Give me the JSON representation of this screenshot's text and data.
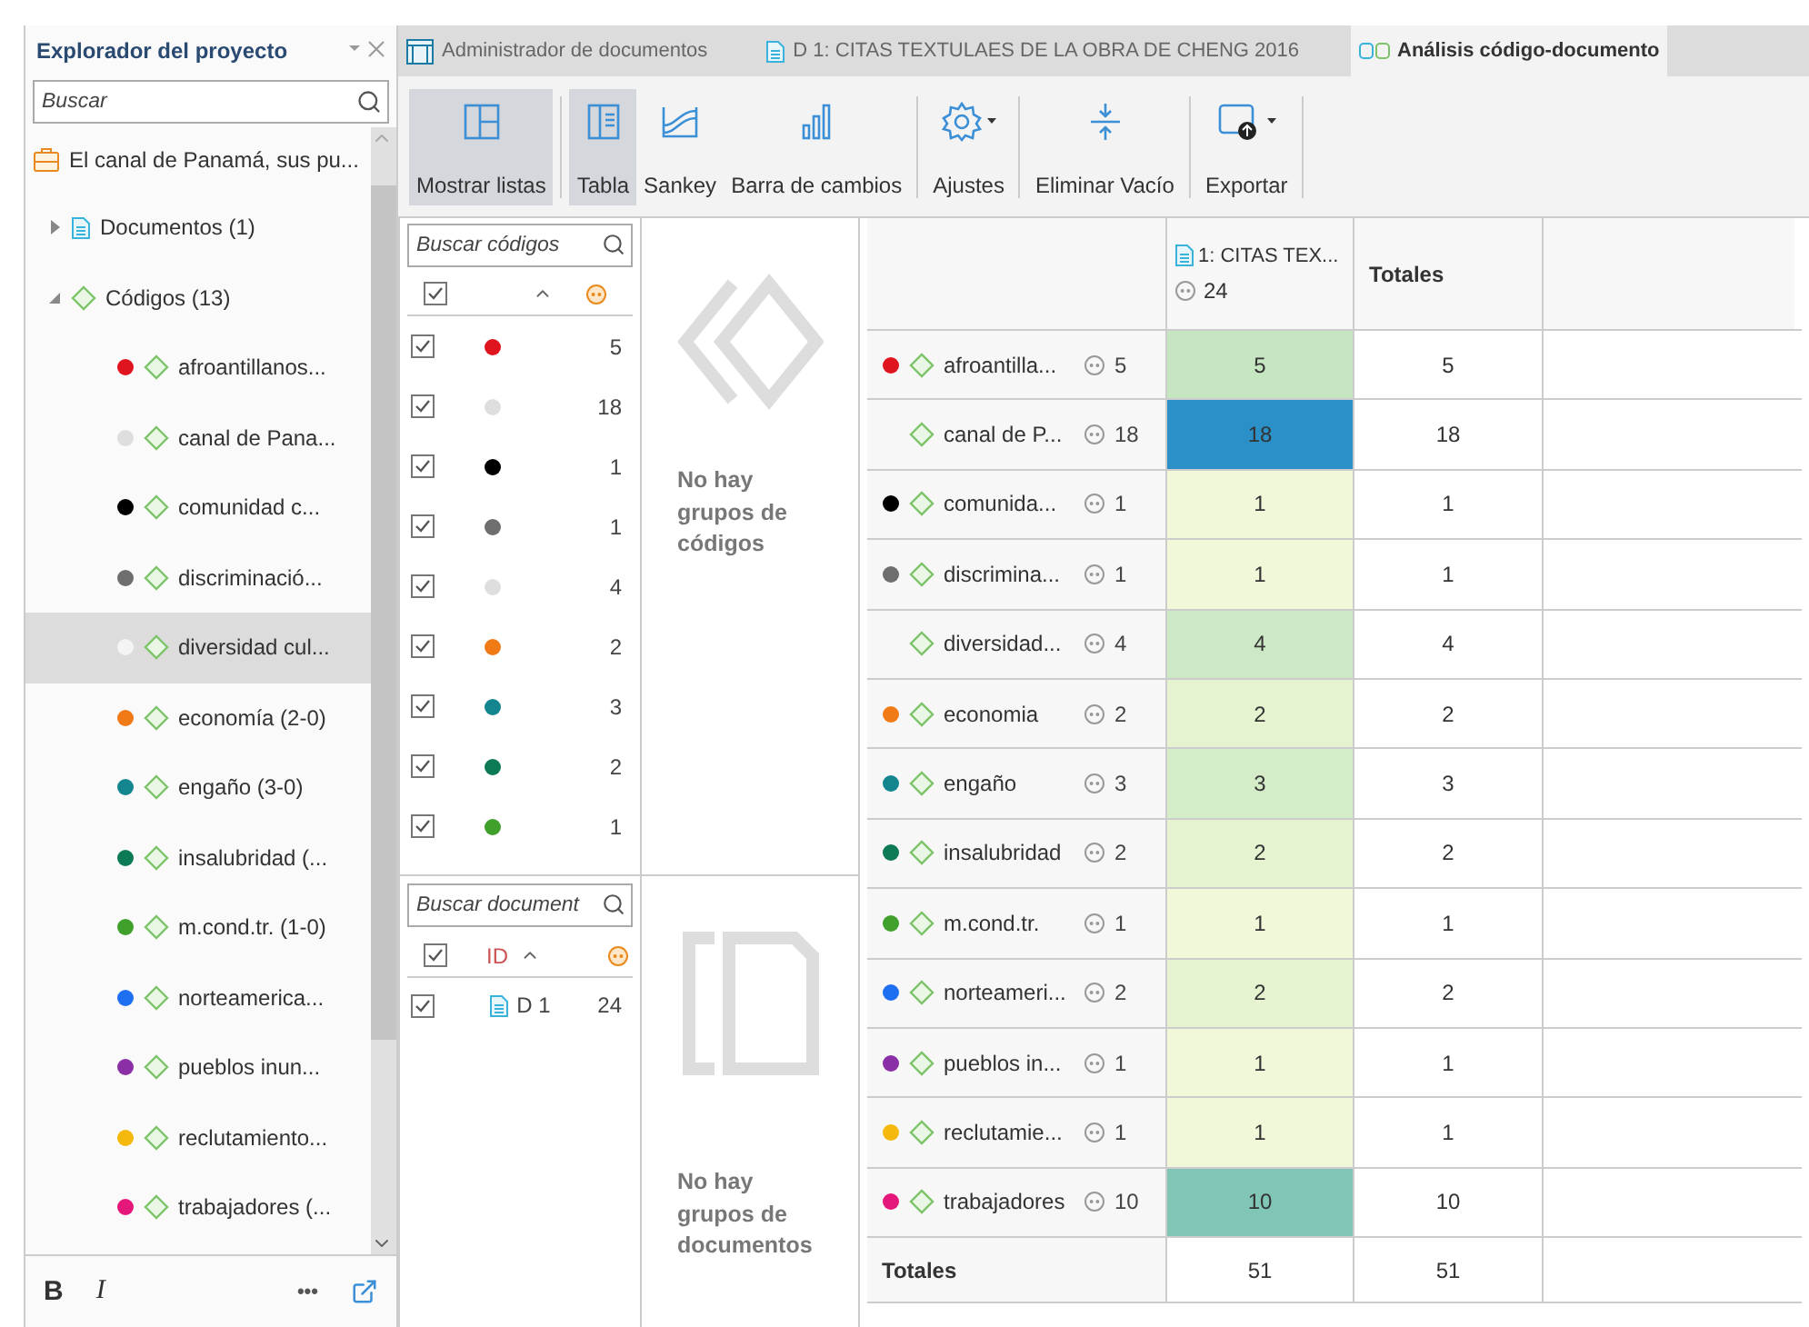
{
  "explorer": {
    "title": "Explorador del proyecto",
    "search": {
      "placeholder": "Buscar"
    },
    "project": "El canal de Panamá, sus pu...",
    "tree": [
      {
        "kind": "documents",
        "label": "Documentos (1)",
        "expanded": false
      },
      {
        "kind": "codes",
        "label": "Códigos (13)",
        "expanded": true,
        "children": [
          {
            "label": "afroantillanos...",
            "color": "#e0141e",
            "selected": false
          },
          {
            "label": "canal de Pana...",
            "color": "#dedede",
            "selected": false
          },
          {
            "label": "comunidad c...",
            "color": "#000000",
            "selected": false
          },
          {
            "label": "discriminació...",
            "color": "#6e6e6e",
            "selected": false
          },
          {
            "label": "diversidad cul...",
            "color": "#f4f4f4",
            "selected": true
          },
          {
            "label": "economía (2-0)",
            "color": "#f07a16",
            "selected": false
          },
          {
            "label": "engaño (3-0)",
            "color": "#13858f",
            "selected": false
          },
          {
            "label": "insalubridad (...",
            "color": "#0b7a55",
            "selected": false
          },
          {
            "label": "m.cond.tr. (1-0)",
            "color": "#3fa02c",
            "selected": false
          },
          {
            "label": "norteamerica...",
            "color": "#1f6ff2",
            "selected": false
          },
          {
            "label": "pueblos inun...",
            "color": "#8a2fa6",
            "selected": false
          },
          {
            "label": "reclutamiento...",
            "color": "#f5b90e",
            "selected": false
          },
          {
            "label": "trabajadores (...",
            "color": "#e5177a",
            "selected": false
          }
        ]
      }
    ],
    "footer": {
      "bold": "B",
      "italic": "I",
      "more": "•••"
    }
  },
  "tabs": [
    {
      "label": "Administrador de documentos",
      "kind": "manager",
      "selected": false
    },
    {
      "label": "D 1: CITAS TEXTULAES DE LA OBRA DE CHENG 2016",
      "kind": "document",
      "selected": false
    },
    {
      "label": "Análisis código-documento",
      "kind": "analysis",
      "selected": true
    }
  ],
  "toolbar": [
    {
      "label": "Mostrar listas",
      "kind": "lists",
      "selected": true,
      "menu": false
    },
    {
      "label": "Tabla",
      "kind": "table",
      "selected": true,
      "menu": false
    },
    {
      "label": "Sankey",
      "kind": "sankey",
      "selected": false,
      "menu": false
    },
    {
      "label": "Barra de cambios",
      "kind": "bars",
      "selected": false,
      "menu": false
    },
    {
      "label": "Ajustes",
      "kind": "settings",
      "selected": false,
      "menu": true
    },
    {
      "label": "Eliminar Vacío",
      "kind": "collapse",
      "selected": false,
      "menu": false
    },
    {
      "label": "Exportar",
      "kind": "export",
      "selected": false,
      "menu": true
    }
  ],
  "code_list": {
    "search": {
      "placeholder": "Buscar códigos"
    },
    "all_checked": true,
    "rows": [
      {
        "checked": true,
        "color": "#e0141e",
        "count": "5"
      },
      {
        "checked": true,
        "color": "#dedede",
        "count": "18"
      },
      {
        "checked": true,
        "color": "#000000",
        "count": "1"
      },
      {
        "checked": true,
        "color": "#6e6e6e",
        "count": "1"
      },
      {
        "checked": true,
        "color": "#dedede",
        "count": "4"
      },
      {
        "checked": true,
        "color": "#f07a16",
        "count": "2"
      },
      {
        "checked": true,
        "color": "#13858f",
        "count": "3"
      },
      {
        "checked": true,
        "color": "#0b7a55",
        "count": "2"
      },
      {
        "checked": true,
        "color": "#3fa02c",
        "count": "1"
      }
    ]
  },
  "code_groups": {
    "message": "No hay grupos de códigos"
  },
  "document_list": {
    "search": {
      "placeholder": "Buscar document"
    },
    "all_checked": true,
    "id_header": "ID",
    "rows": [
      {
        "checked": true,
        "id": "D 1",
        "count": "24"
      }
    ]
  },
  "document_groups": {
    "message": "No hay grupos de documentos"
  },
  "table": {
    "doc_column": {
      "title": "1: CITAS TEX...",
      "count": "24"
    },
    "totals_header": "Totales",
    "rows": [
      {
        "color": "#e0141e",
        "label": "afroantilla...",
        "count": "5",
        "cell": {
          "value": "5",
          "color": "#c6e5c1"
        },
        "total": "5"
      },
      {
        "label": "canal de P...",
        "count": "18",
        "cell": {
          "value": "18",
          "color": "#2b8fc8"
        },
        "total": "18"
      },
      {
        "color": "#000000",
        "label": "comunida...",
        "count": "1",
        "cell": {
          "value": "1",
          "color": "#f1f8da"
        },
        "total": "1"
      },
      {
        "color": "#6e6e6e",
        "label": "discrimina...",
        "count": "1",
        "cell": {
          "value": "1",
          "color": "#f1f8da"
        },
        "total": "1"
      },
      {
        "label": "diversidad...",
        "count": "4",
        "cell": {
          "value": "4",
          "color": "#cce8c5"
        },
        "total": "4"
      },
      {
        "color": "#f07a16",
        "label": "economia",
        "count": "2",
        "cell": {
          "value": "2",
          "color": "#e5f3d1"
        },
        "total": "2"
      },
      {
        "color": "#13858f",
        "label": "engaño",
        "count": "3",
        "cell": {
          "value": "3",
          "color": "#d5ecc9"
        },
        "total": "3"
      },
      {
        "color": "#0b7a55",
        "label": "insalubridad",
        "count": "2",
        "cell": {
          "value": "2",
          "color": "#e5f3d1"
        },
        "total": "2"
      },
      {
        "color": "#3fa02c",
        "label": "m.cond.tr.",
        "count": "1",
        "cell": {
          "value": "1",
          "color": "#f1f8da"
        },
        "total": "1"
      },
      {
        "color": "#1f6ff2",
        "label": "norteameri...",
        "count": "2",
        "cell": {
          "value": "2",
          "color": "#e5f3d1"
        },
        "total": "2"
      },
      {
        "color": "#8a2fa6",
        "label": "pueblos in...",
        "count": "1",
        "cell": {
          "value": "1",
          "color": "#f1f8da"
        },
        "total": "1"
      },
      {
        "color": "#f5b90e",
        "label": "reclutamie...",
        "count": "1",
        "cell": {
          "value": "1",
          "color": "#f1f8da"
        },
        "total": "1"
      },
      {
        "color": "#e5177a",
        "label": "trabajadores",
        "count": "10",
        "cell": {
          "value": "10",
          "color": "#80c5b5"
        },
        "total": "10"
      }
    ],
    "totals": {
      "label": "Totales",
      "value": "51",
      "total": "51"
    }
  }
}
